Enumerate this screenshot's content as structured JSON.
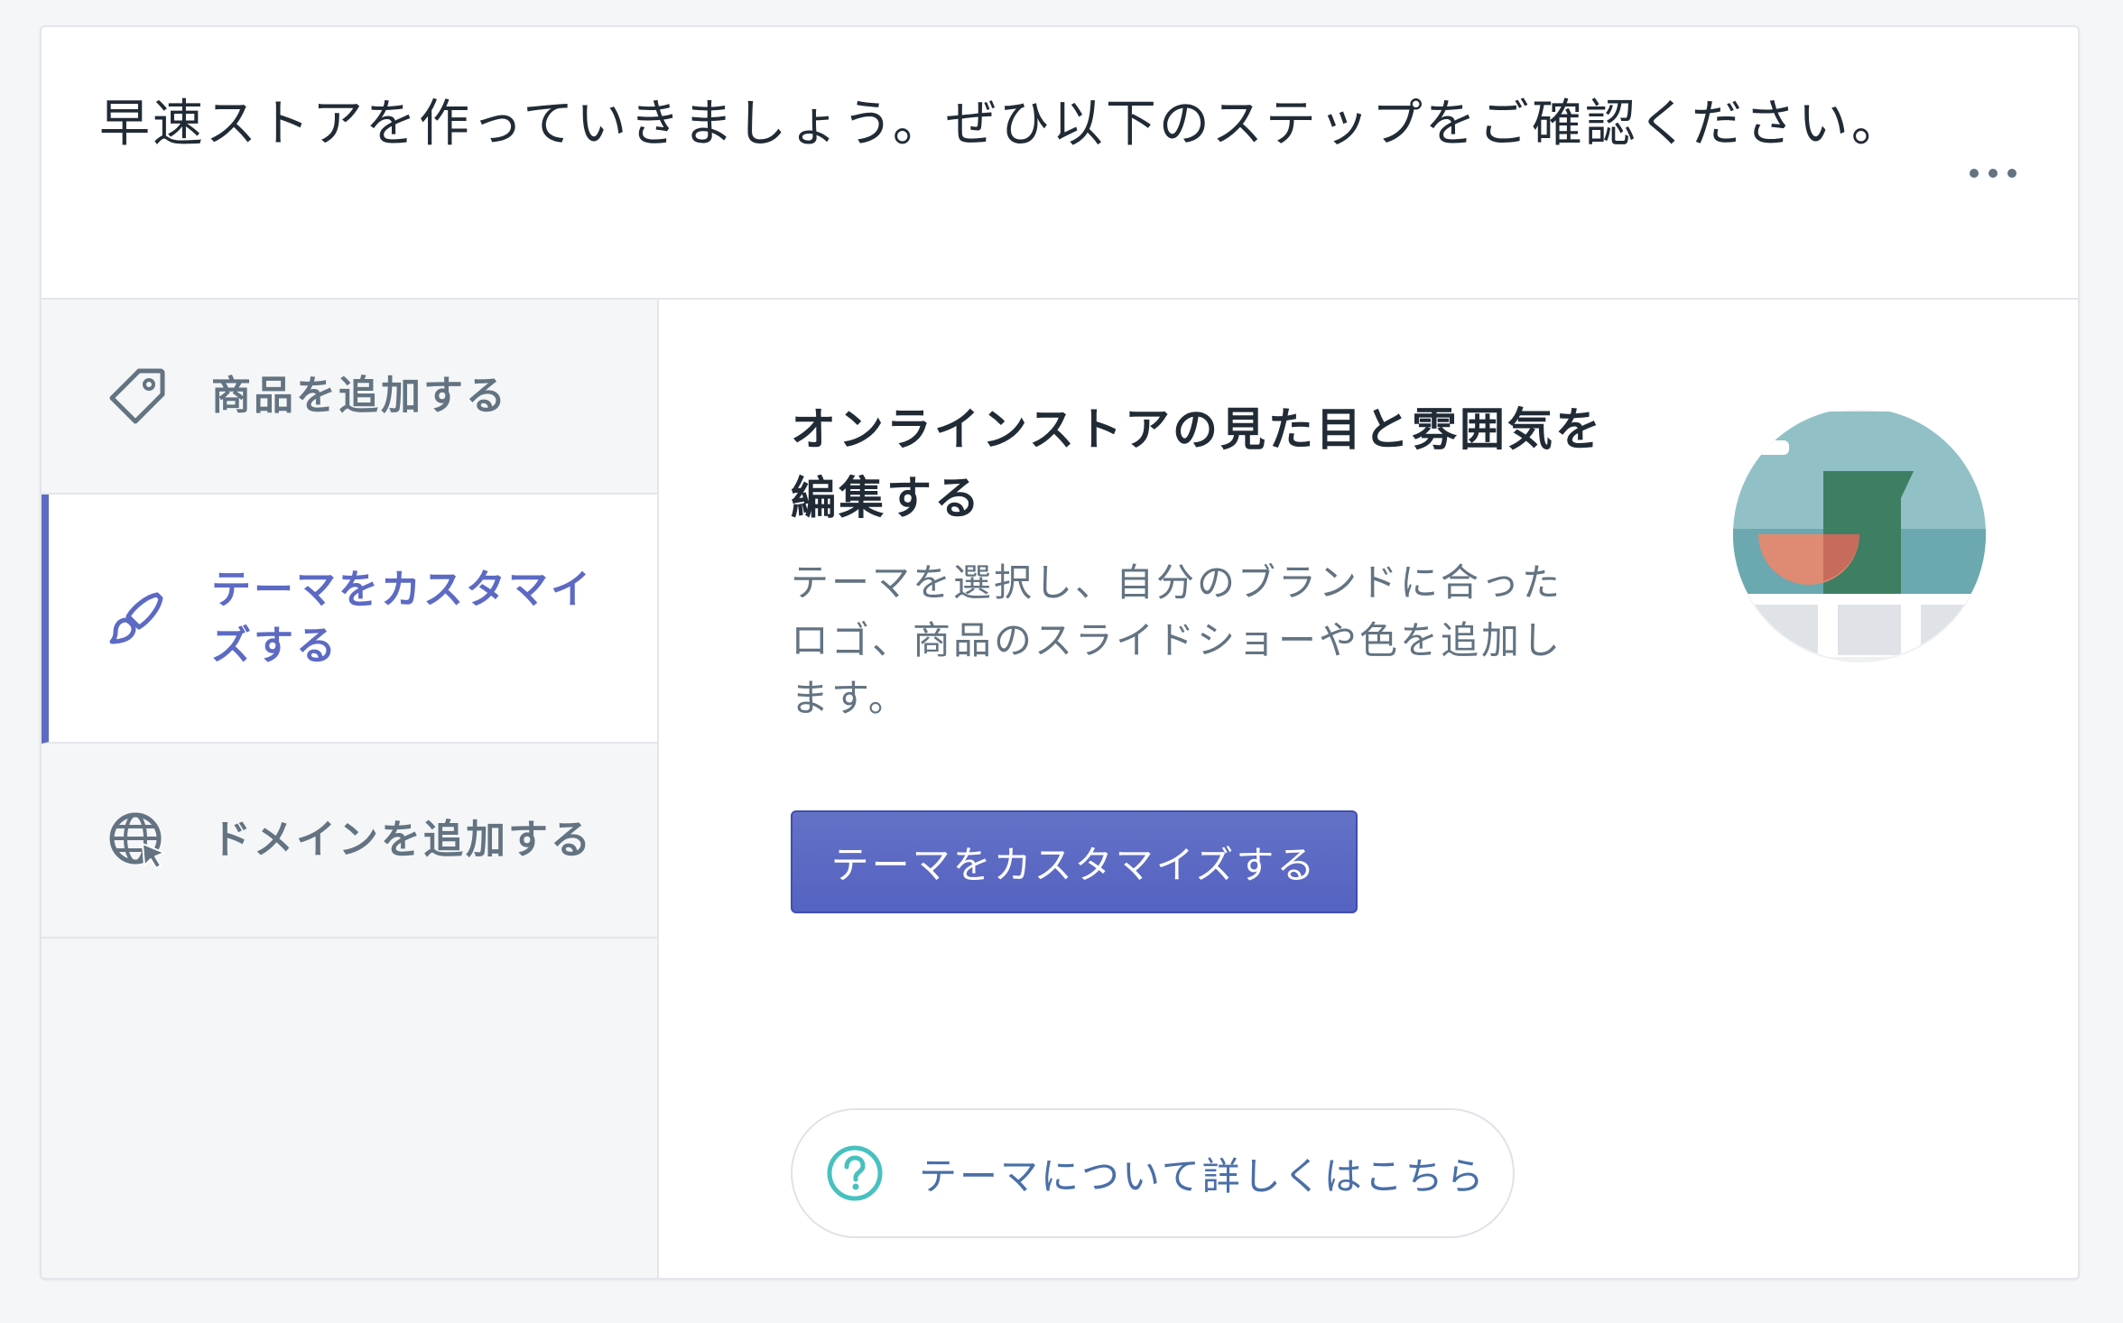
{
  "header": {
    "title": "早速ストアを作っていきましょう。ぜひ以下のステップをご確認ください。",
    "more_icon": "more-horizontal-icon"
  },
  "steps": [
    {
      "label": "商品を追加する",
      "icon": "tag-icon",
      "active": false
    },
    {
      "label": "テーマをカスタマイズする",
      "icon": "paintbrush-icon",
      "active": true
    },
    {
      "label": "ドメインを追加する",
      "icon": "globe-cursor-icon",
      "active": false
    }
  ],
  "content": {
    "heading": "オンラインストアの見た目と雰囲気を編集する",
    "description": "テーマを選択し、自分のブランドに合ったロゴ、商品のスライドショーや色を追加します。",
    "primary_button_label": "テーマをカスタマイズする",
    "help_link_label": "テーマについて詳しくはこちら",
    "help_icon": "question-circle-icon",
    "illustration": "theme-preview-illustration"
  },
  "colors": {
    "accent": "#5c6ac4",
    "text_primary": "#212b36",
    "text_secondary": "#637381",
    "border": "#e3e6ea",
    "sidebar_bg": "#f4f6f8",
    "help_icon": "#47c1bf"
  }
}
